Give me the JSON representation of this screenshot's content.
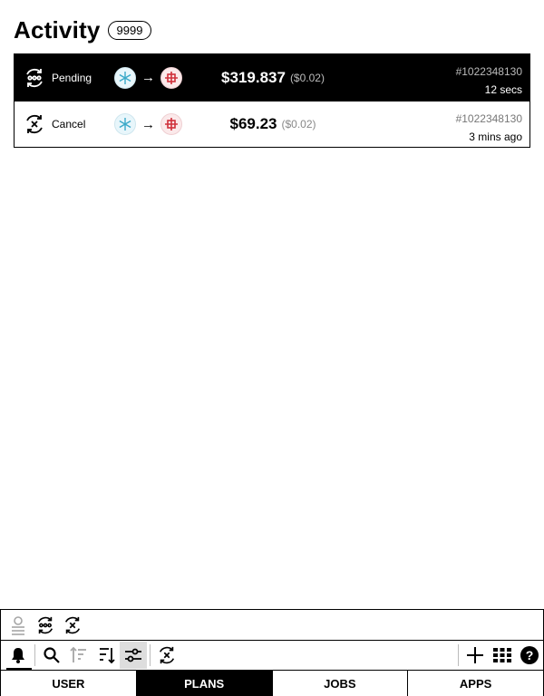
{
  "header": {
    "title": "Activity",
    "count": "9999"
  },
  "activity": [
    {
      "status": "Pending",
      "status_icon": "pending-cycle-icon",
      "from_token": "snowflake-token-icon",
      "to_token": "red-emblem-token-icon",
      "amount": "$319.837",
      "fee": "($0.02)",
      "id": "#1022348130",
      "time": "12 secs",
      "selected": true
    },
    {
      "status": "Cancel",
      "status_icon": "cancel-cycle-icon",
      "from_token": "snowflake-token-icon",
      "to_token": "red-emblem-token-icon",
      "amount": "$69.23",
      "fee": "($0.02)",
      "id": "#1022348130",
      "time": "3 mins ago",
      "selected": false
    }
  ],
  "arrow": "→",
  "toolbar_top": [
    "confirmed-filter-icon",
    "pending-filter-icon",
    "cancel-filter-icon"
  ],
  "toolbar_bottom": [
    "bell-icon",
    "search-icon",
    "sort-ascending-icon",
    "sort-descending-icon",
    "filter-sliders-icon",
    "cancel-filter-icon",
    "plus-icon",
    "grid-icon",
    "help-icon"
  ],
  "tabs": [
    {
      "label": "USER",
      "active": false
    },
    {
      "label": "PLANS",
      "active": true
    },
    {
      "label": "JOBS",
      "active": false
    },
    {
      "label": "APPS",
      "active": false
    }
  ],
  "colors": {
    "selected_bg": "#000000",
    "token_a": "#3aa9c8",
    "token_b": "#d0303a"
  }
}
